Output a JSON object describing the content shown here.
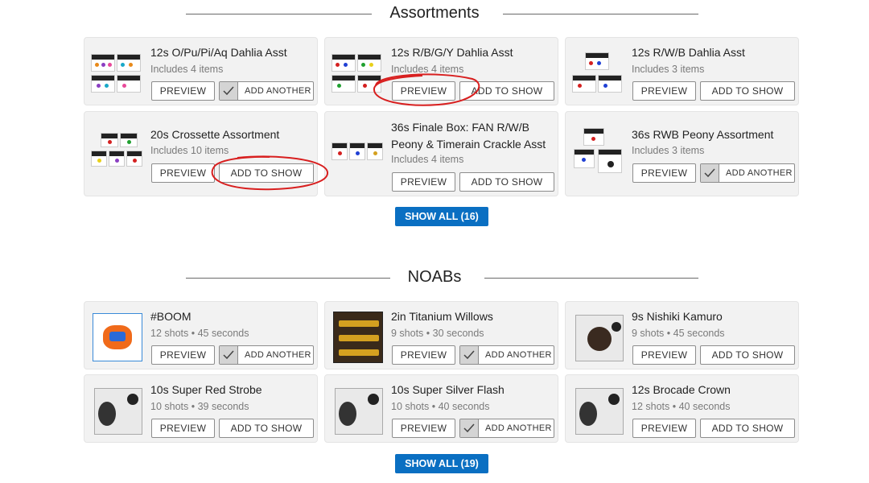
{
  "sections": [
    {
      "title": "Assortments",
      "items": [
        {
          "name": "12s O/Pu/Pi/Aq Dahlia Asst",
          "meta": "Includes 4 items",
          "state": "added"
        },
        {
          "name": "12s R/B/G/Y Dahlia Asst",
          "meta": "Includes 4 items",
          "state": "add"
        },
        {
          "name": "12s R/W/B Dahlia Asst",
          "meta": "Includes 3 items",
          "state": "add"
        },
        {
          "name": "20s Crossette Assortment",
          "meta": "Includes 10 items",
          "state": "add"
        },
        {
          "name_line1": "36s Finale Box: FAN R/W/B",
          "name_line2": "Peony & Timerain Crackle Asst",
          "meta": "Includes 4 items",
          "state": "add"
        },
        {
          "name": "36s RWB Peony Assortment",
          "meta": "Includes 3 items",
          "state": "added"
        }
      ],
      "show_all": "SHOW ALL (16)"
    },
    {
      "title": "NOABs",
      "items": [
        {
          "name": "#BOOM",
          "meta": "12 shots • 45 seconds",
          "state": "added"
        },
        {
          "name": "2in Titanium Willows",
          "meta": "9 shots • 30 seconds",
          "state": "added"
        },
        {
          "name": "9s Nishiki Kamuro",
          "meta": "9 shots • 45 seconds",
          "state": "add"
        },
        {
          "name": "10s Super Red Strobe",
          "meta": "10 shots • 39 seconds",
          "state": "add"
        },
        {
          "name": "10s Super Silver Flash",
          "meta": "10 shots • 40 seconds",
          "state": "added"
        },
        {
          "name": "12s Brocade Crown",
          "meta": "12 shots • 40 seconds",
          "state": "add"
        }
      ],
      "show_all": "SHOW ALL (19)"
    }
  ],
  "labels": {
    "preview": "PREVIEW",
    "add_to_show": "ADD TO SHOW",
    "add_another": "ADD ANOTHER"
  },
  "colors": {
    "accent": "#0a6fc2",
    "annotation": "#d81f1f",
    "card_bg": "#f2f2f2"
  },
  "icons": {
    "check": "check-icon"
  }
}
